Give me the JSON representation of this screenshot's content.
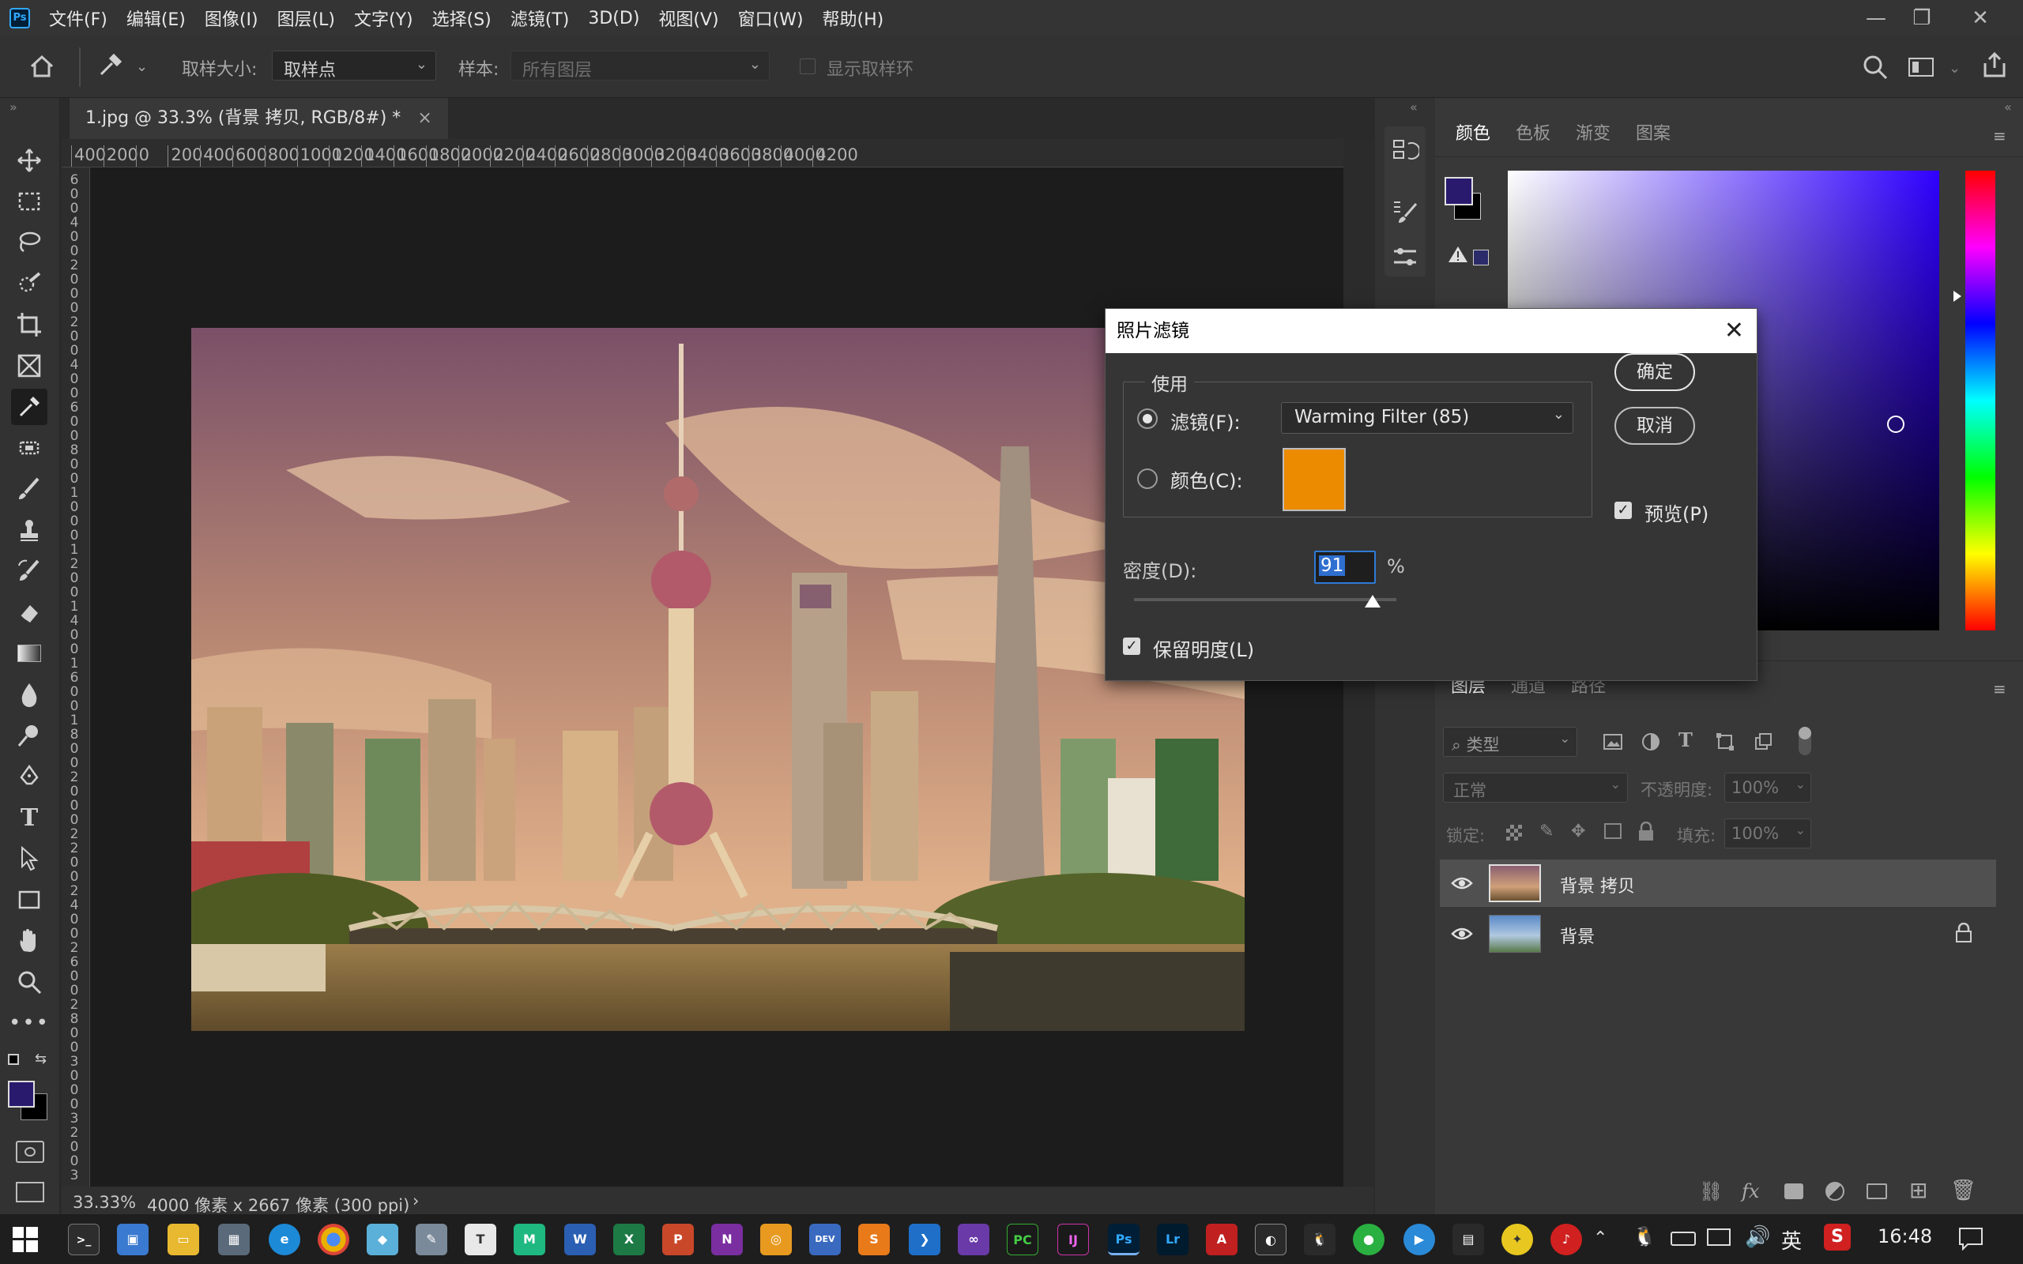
{
  "app": {
    "name": "Ps"
  },
  "menu": [
    "文件(F)",
    "编辑(E)",
    "图像(I)",
    "图层(L)",
    "文字(Y)",
    "选择(S)",
    "滤镜(T)",
    "3D(D)",
    "视图(V)",
    "窗口(W)",
    "帮助(H)"
  ],
  "window_controls": {
    "minimize": "—",
    "restore": "❐",
    "close": "✕"
  },
  "options": {
    "sample_size_label": "取样大小:",
    "sample_size_value": "取样点",
    "sample_label": "样本:",
    "sample_value": "所有图层",
    "show_ring_label": "显示取样环"
  },
  "document": {
    "tab_title": "1.jpg @ 33.3% (背景 拷贝, RGB/8#) *",
    "close_glyph": "×"
  },
  "ruler": {
    "h_ticks": [
      "400",
      "200",
      "0",
      "200",
      "400",
      "600",
      "800",
      "1000",
      "1200",
      "1400",
      "1600",
      "1800",
      "2000",
      "2200",
      "2400",
      "2600",
      "2800",
      "3000",
      "3200",
      "3400",
      "3600",
      "3800",
      "4000",
      "4200"
    ],
    "v_ticks": [
      "6",
      "0",
      "0",
      "4",
      "0",
      "0",
      "2",
      "0",
      "0",
      "0",
      "2",
      "0",
      "0",
      "4",
      "0",
      "0",
      "6",
      "0",
      "0",
      "8",
      "0",
      "0",
      "1",
      "0",
      "0",
      "0",
      "1",
      "2",
      "0",
      "0",
      "1",
      "4",
      "0",
      "0",
      "1",
      "6",
      "0",
      "0",
      "1",
      "8",
      "0",
      "0",
      "2",
      "0",
      "0",
      "0",
      "2",
      "2",
      "0",
      "0",
      "2",
      "4",
      "0",
      "0",
      "2",
      "6",
      "0",
      "0",
      "2",
      "8",
      "0",
      "0",
      "3",
      "0",
      "0",
      "0",
      "3",
      "2",
      "0",
      "0",
      "3"
    ]
  },
  "status": {
    "zoom": "33.33%",
    "doc_info": "4000 像素 x 2667 像素 (300 ppi)",
    "arrow": "›"
  },
  "color_panel": {
    "tabs": [
      "颜色",
      "色板",
      "渐变",
      "图案"
    ],
    "foreground": "#2a1a6e",
    "background": "#000000",
    "picked_hue": "#2f00ff"
  },
  "layers_panel": {
    "tabs": [
      "图层",
      "通道",
      "路径"
    ],
    "filter_label": "类型",
    "blend_mode": "正常",
    "opacity_label": "不透明度:",
    "opacity_value": "100%",
    "lock_label": "锁定:",
    "fill_label": "填充:",
    "fill_value": "100%",
    "layers": [
      {
        "name": "背景 拷贝",
        "selected": true,
        "visible": true,
        "locked": false
      },
      {
        "name": "背景",
        "selected": false,
        "visible": true,
        "locked": true
      }
    ]
  },
  "dialog": {
    "title": "照片滤镜",
    "group_label": "使用",
    "filter_label": "滤镜(F):",
    "filter_value": "Warming Filter (85)",
    "color_label": "颜色(C):",
    "swatch_color": "#ec8a00",
    "density_label": "密度(D):",
    "density_value": "91",
    "density_unit": "%",
    "density_fraction": 0.91,
    "preserve_label": "保留明度(L)",
    "preview_label": "预览(P)",
    "ok_label": "确定",
    "cancel_label": "取消",
    "filter_selected": true,
    "preserve_checked": true,
    "preview_checked": true
  },
  "taskbar": {
    "time": "16:48",
    "ime": "英"
  }
}
